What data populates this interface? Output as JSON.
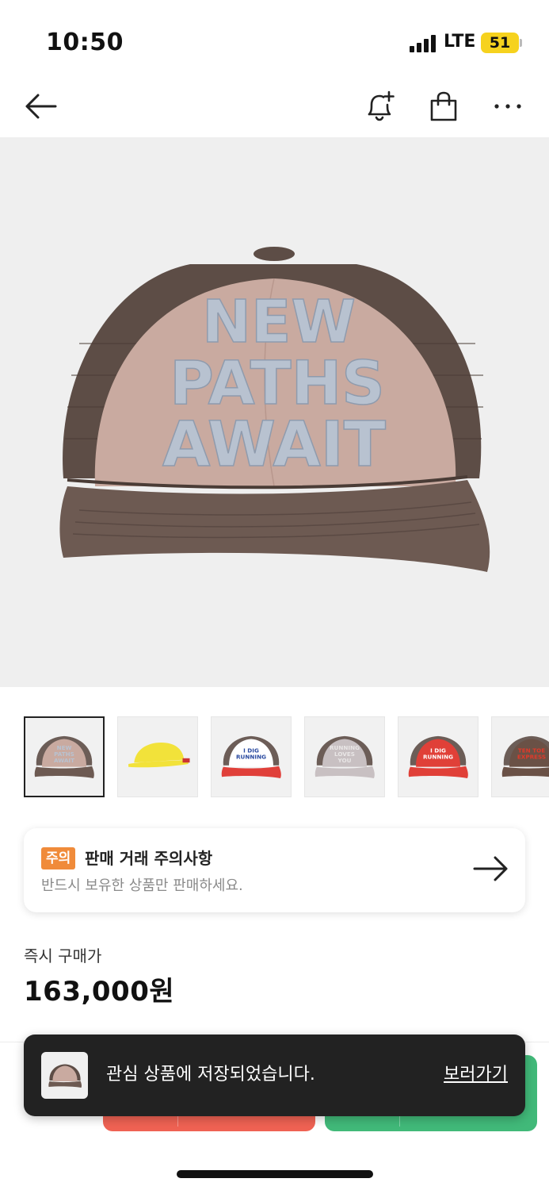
{
  "status": {
    "time": "10:50",
    "network": "LTE",
    "battery": "51"
  },
  "nav": {
    "icons": [
      "back-arrow-icon",
      "bell-plus-icon",
      "shopping-bag-icon",
      "more-icon"
    ]
  },
  "hero": {
    "cap_text": [
      "NEW",
      "PATHS",
      "AWAIT"
    ],
    "colors": {
      "crown": "#c9aaa0",
      "brim": "#6d5a52",
      "mesh": "#5d4d46",
      "embroidery": "#b8c2d0"
    }
  },
  "thumbnails": [
    {
      "lines": [
        "NEW",
        "PATHS",
        "AWAIT"
      ],
      "crown": "#c9aaa0",
      "brim": "#6d5a52",
      "text_color": "#b8c2d0",
      "selected": true
    },
    {
      "lines": [],
      "crown": "#f2e23a",
      "brim": "#f2e23a",
      "text_color": "#c33",
      "selected": false,
      "style": "flat"
    },
    {
      "lines": [
        "I DIG",
        "RUNNING"
      ],
      "crown": "#ffffff",
      "brim": "#e0403a",
      "text_color": "#2a4aa0",
      "selected": false
    },
    {
      "lines": [
        "RUNNING",
        "LOVES",
        "YOU"
      ],
      "crown": "#c8c0c2",
      "brim": "#c8c0c2",
      "text_color": "#e9e6e6",
      "selected": false
    },
    {
      "lines": [
        "I DIG",
        "RUNNING"
      ],
      "crown": "#e04038",
      "brim": "#e04038",
      "text_color": "#ffffff",
      "selected": false
    },
    {
      "lines": [
        "TEN TOE",
        "EXPRESS"
      ],
      "crown": "#6a5146",
      "brim": "#6a5146",
      "text_color": "#e03a2a",
      "selected": false
    }
  ],
  "notice": {
    "badge": "주의",
    "title": "판매 거래 주의사항",
    "subtitle": "반드시 보유한 상품만 판매하세요."
  },
  "price": {
    "label": "즉시 구매가",
    "value": "163,000원"
  },
  "toast": {
    "message": "관심 상품에 저장되었습니다.",
    "link": "보러가기"
  },
  "buttons": {
    "buy_color": "#ef6253",
    "sell_color": "#41b979"
  }
}
